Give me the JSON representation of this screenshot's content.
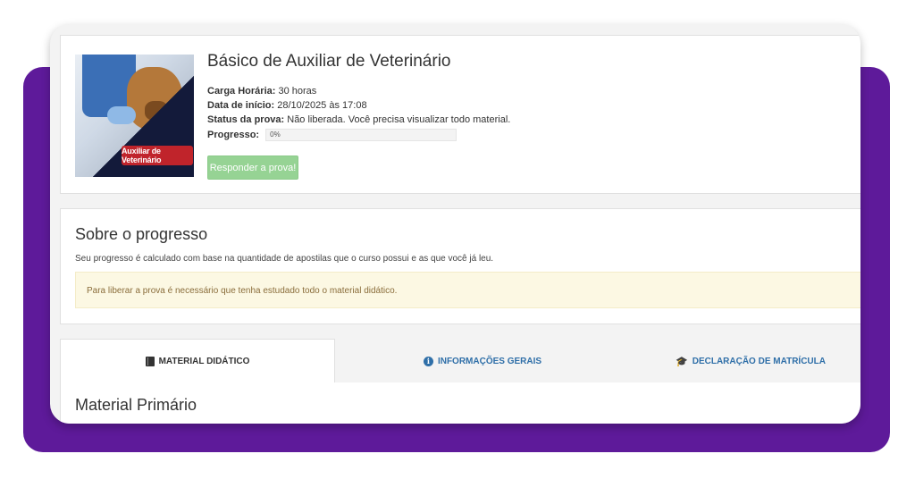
{
  "course": {
    "title": "Básico de Auxiliar de Veterinário",
    "image_banner": "Auxiliar de Veterinário",
    "workload_label": "Carga Horária:",
    "workload_value": "30 horas",
    "start_label": "Data de início:",
    "start_value": "28/10/2025 às 17:08",
    "status_label": "Status da prova:",
    "status_value": "Não liberada. Você precisa visualizar todo material.",
    "progress_label": "Progresso:",
    "progress_value": "0%",
    "progress_fraction": 0,
    "answer_button": "Responder a prova!"
  },
  "progress_section": {
    "title": "Sobre o progresso",
    "description": "Seu progresso é calculado com base na quantidade de apostilas que o curso possui e as que você já leu.",
    "alert": "Para liberar a prova é necessário que tenha estudado todo o material didático."
  },
  "tabs": [
    {
      "label": "MATERIAL DIDÁTICO",
      "icon": "book-icon"
    },
    {
      "label": "INFORMAÇÕES GERAIS",
      "icon": "info-icon"
    },
    {
      "label": "DECLARAÇÃO DE MATRÍCULA",
      "icon": "graduation-cap-icon"
    }
  ],
  "content": {
    "title": "Material Primário"
  },
  "colors": {
    "frame_purple": "#5e1a9a",
    "button_green": "#96d394",
    "alert_bg": "#fcf8e3",
    "link_blue": "#2f6fa8"
  }
}
